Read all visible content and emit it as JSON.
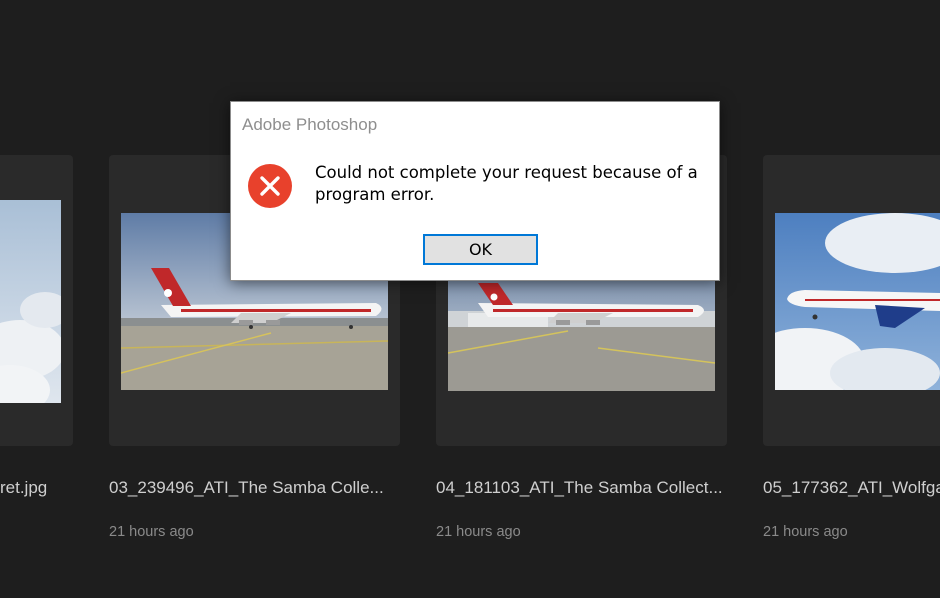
{
  "dialog": {
    "title": "Adobe Photoshop",
    "icon": "error-icon",
    "message": "Could not complete your request because of a program error.",
    "ok_label": "OK"
  },
  "files": [
    {
      "name": "ret.jpg",
      "time": "21 hours ago"
    },
    {
      "name": "03_239496_ATI_The Samba Colle...",
      "time": "21 hours ago"
    },
    {
      "name": "04_181103_ATI_The Samba Collect...",
      "time": "21 hours ago"
    },
    {
      "name": "05_177362_ATI_Wolfga",
      "time": "21 hours ago"
    }
  ],
  "colors": {
    "background": "#1e1e1e",
    "card": "#2a2a2a",
    "error_red": "#e8412c",
    "button_border": "#0078d7"
  }
}
